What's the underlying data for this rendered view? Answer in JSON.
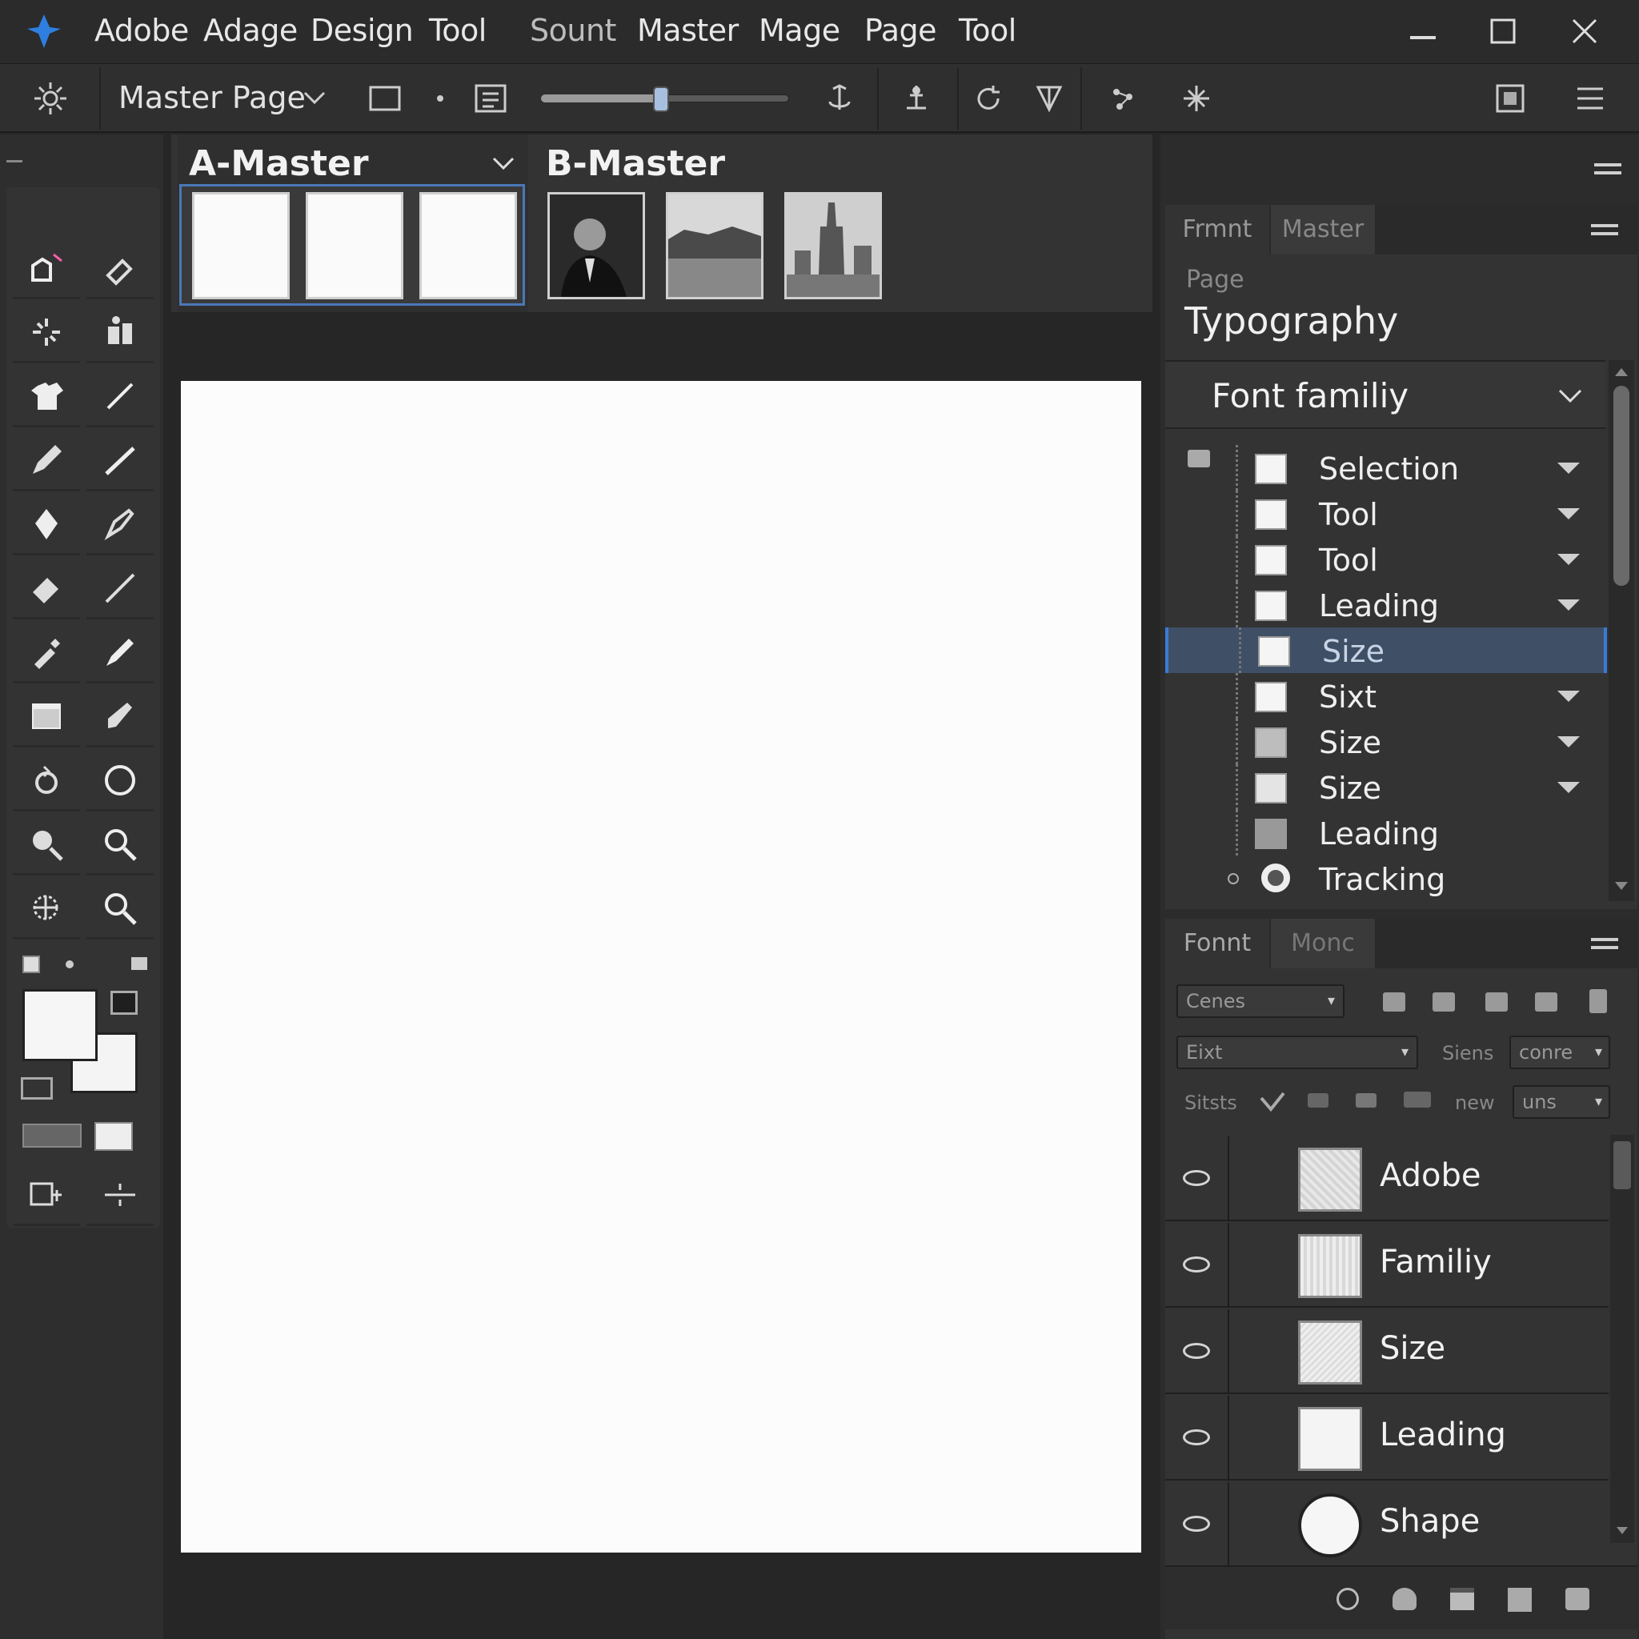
{
  "menubar": {
    "items": [
      "Adobe",
      "Adage",
      "Design",
      "Tool",
      "Sount",
      "Master",
      "Mage",
      "Page",
      "Tool"
    ]
  },
  "toolbar": {
    "page_select": "Master Page"
  },
  "pages": {
    "a_master": "A-Master",
    "b_master": "B-Master"
  },
  "right_top": {
    "tabs": [
      "Frmnt",
      "Master"
    ],
    "breadcrumb": "Page",
    "title": "Typography",
    "font_family": "Font familiy",
    "properties": [
      "Selection",
      "Tool",
      "Tool",
      "Leading",
      "Size",
      "Sixt",
      "Size",
      "Size",
      "Leading",
      "Tracking"
    ]
  },
  "right_bottom": {
    "tabs": [
      "Fonnt",
      "Monc"
    ],
    "font_select": "Cenes",
    "style_select": "Eixt",
    "size_label": "Siens",
    "size_value": "conre",
    "row3_label": "Sitsts",
    "row3_misc": "new",
    "row3_value": "uns",
    "layers": [
      "Adobe",
      "Familiy",
      "Size",
      "Leading",
      "Shape"
    ]
  },
  "colors": {
    "accent": "#2e7fe0",
    "selection": "#3f4f66",
    "highlight_border": "#3a7bd5"
  }
}
